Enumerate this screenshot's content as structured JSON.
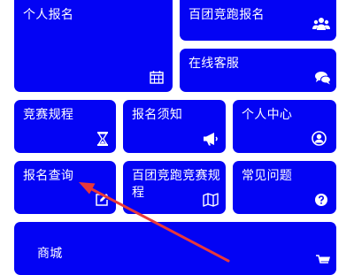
{
  "tiles": {
    "personal_signup": {
      "label": "个人报名",
      "icon": "calendar-icon"
    },
    "team_signup": {
      "label": "百团竞跑报名",
      "icon": "users-icon"
    },
    "online_service": {
      "label": "在线客服",
      "icon": "chat-icon"
    },
    "rules": {
      "label": "竞赛规程",
      "icon": "hourglass-icon"
    },
    "notice": {
      "label": "报名须知",
      "icon": "megaphone-icon"
    },
    "personal_center": {
      "label": "个人中心",
      "icon": "user-circle-icon"
    },
    "signup_query": {
      "label": "报名查询",
      "icon": "edit-icon"
    },
    "team_rules": {
      "label": "百团竞跑竞赛规程",
      "icon": "map-icon"
    },
    "faq": {
      "label": "常见问题",
      "icon": "question-circle-icon"
    },
    "shop": {
      "label": "商城",
      "icon": "cart-icon"
    }
  },
  "colors": {
    "tile_bg": "#0303f4",
    "tile_text": "#ffffff",
    "annotation_arrow": "#e8383a"
  }
}
